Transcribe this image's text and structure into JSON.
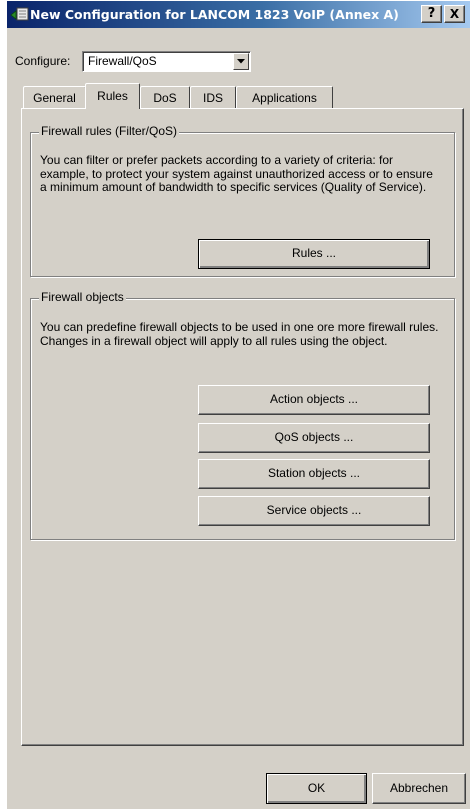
{
  "window": {
    "title": "New Configuration for LANCOM 1823 VoIP (Annex A)",
    "help_label": "?",
    "close_label": "X",
    "titlebar_color": "#0a246a",
    "face_color": "#d4d0c8"
  },
  "configure": {
    "label": "Configure:",
    "value": "Firewall/QoS"
  },
  "tabs": [
    {
      "label": "General",
      "active": false
    },
    {
      "label": "Rules",
      "active": true
    },
    {
      "label": "DoS",
      "active": false
    },
    {
      "label": "IDS",
      "active": false
    },
    {
      "label": "Applications",
      "active": false
    }
  ],
  "firewall_rules": {
    "title": "Firewall rules (Filter/QoS)",
    "description": "You can filter or prefer packets according to a variety of criteria: for example, to protect your system against unauthorized access or to ensure a minimum amount of bandwidth to specific services (Quality of Service).",
    "rules_button": "Rules ..."
  },
  "firewall_objects": {
    "title": "Firewall objects",
    "description": "You can predefine firewall objects to be used in one ore more firewall rules. Changes in a firewall object will apply to all rules using the object.",
    "buttons": [
      "Action objects ...",
      "QoS objects ...",
      "Station objects ...",
      "Service objects ..."
    ]
  },
  "footer": {
    "ok_label": "OK",
    "cancel_label": "Abbrechen"
  }
}
